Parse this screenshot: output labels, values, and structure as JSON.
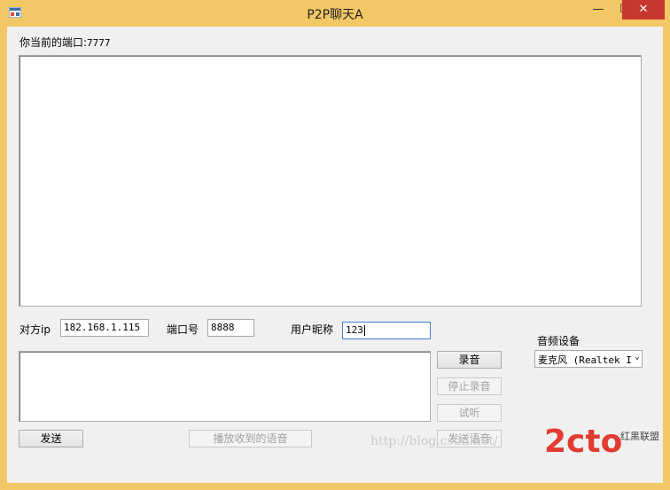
{
  "window": {
    "title": "P2P聊天A"
  },
  "controls": {
    "minimize": "—",
    "maximize": "☐",
    "close": "✕"
  },
  "port_line": {
    "label": "你当前的端口:",
    "value": "7777"
  },
  "peer": {
    "ip_label": "对方ip",
    "ip_value": "182.168.1.115",
    "port_label": "端口号",
    "port_value": "8888",
    "nick_label": "用户昵称",
    "nick_value": "123"
  },
  "audio": {
    "device_label": "音频设备",
    "device_value": "麦克风 (Realtek I"
  },
  "buttons": {
    "record": "录音",
    "stop_record": "停止录音",
    "listen": "试听",
    "send": "发送",
    "play_received": "播放收到的语音",
    "send_voice": "发送语音"
  },
  "watermark": {
    "text": "http://blog.csdn.net/",
    "logo": "2cto",
    "logo_sub": "红黑联盟"
  }
}
